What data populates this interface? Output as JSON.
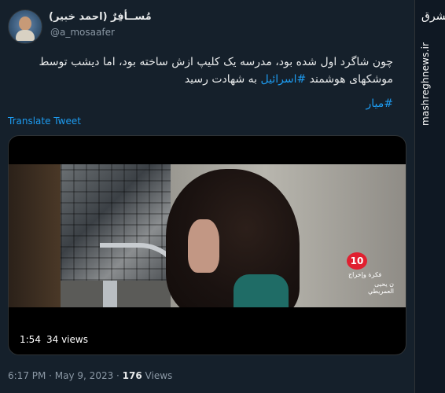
{
  "tweet": {
    "display_name": "مُســأفِرٌ (احمد خبیر)",
    "handle": "@a_mosaafer",
    "text_line1": "چون شاگرد اول شده بود، مدرسه یک کلیپ ازش ساخته بود، اما دیشب توسط",
    "text_line2_pre": "موشکهای هوشمند ",
    "text_hashtag": "#اسرائیل",
    "text_line2_post": " به شهادت رسید",
    "hashtag2": "#میار",
    "translate_label": "Translate Tweet",
    "timestamp_prefix": "6:17 PM · May 9, 2023 · ",
    "views_count": "176",
    "views_label": " Views"
  },
  "media": {
    "duration": "1:54",
    "views": "34 views",
    "channel_number": "10",
    "channel_text1": "فکرة وإخراج",
    "channel_text2": "ن يحيى العمريطي"
  },
  "sidebar": {
    "brand_logo": "مشرق",
    "site": "mashreghnews.ir"
  }
}
